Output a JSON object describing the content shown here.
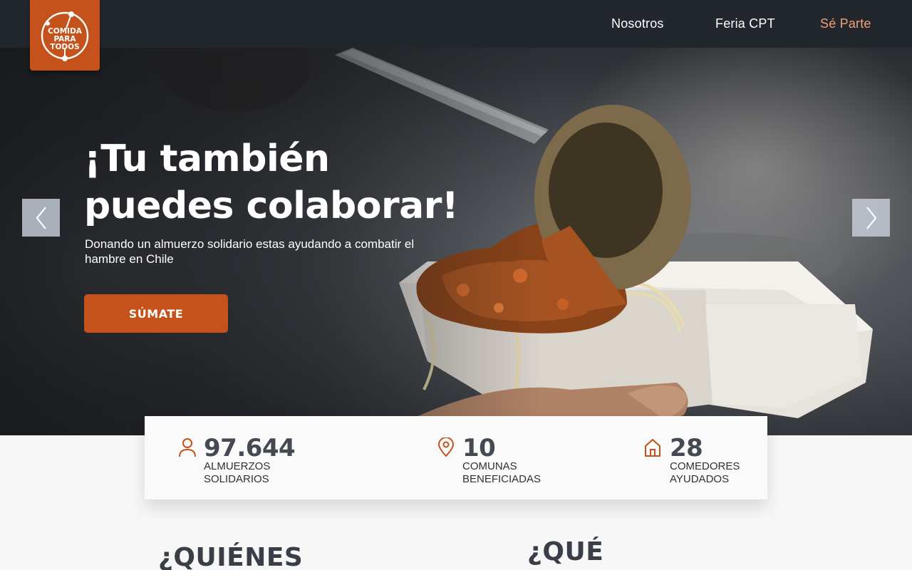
{
  "header": {
    "logo_text": [
      "COMIDA",
      "PARA",
      "TODOS"
    ],
    "nav": [
      {
        "label": "Nosotros"
      },
      {
        "label": "Feria CPT"
      },
      {
        "label": "Sé Parte"
      }
    ],
    "nav_active_color": "#f0a274"
  },
  "hero": {
    "headline_line1": "¡Tu también",
    "headline_line2": "puedes colaborar!",
    "subtitle": "Donando un almuerzo solidario estas ayudando a combatir el hambre en Chile",
    "cta_label": "SÚMATE",
    "prev_icon": "chevron-left-icon",
    "next_icon": "chevron-right-icon"
  },
  "stats": [
    {
      "icon": "person-icon",
      "value": "97.644",
      "label_line1": "ALMUERZOS",
      "label_line2": "SOLIDARIOS"
    },
    {
      "icon": "map-pin-icon",
      "value": "10",
      "label_line1": "COMUNAS",
      "label_line2": "BENEFICIADAS"
    },
    {
      "icon": "home-icon",
      "value": "28",
      "label_line1": "COMEDORES",
      "label_line2": "AYUDADOS"
    }
  ],
  "sections": {
    "who_title": "¿QUIÉNES",
    "what_title": "¿QUÉ"
  },
  "colors": {
    "brand_orange": "#c4521a",
    "nav_bg": "#22262d",
    "stat_text": "#454a52"
  }
}
